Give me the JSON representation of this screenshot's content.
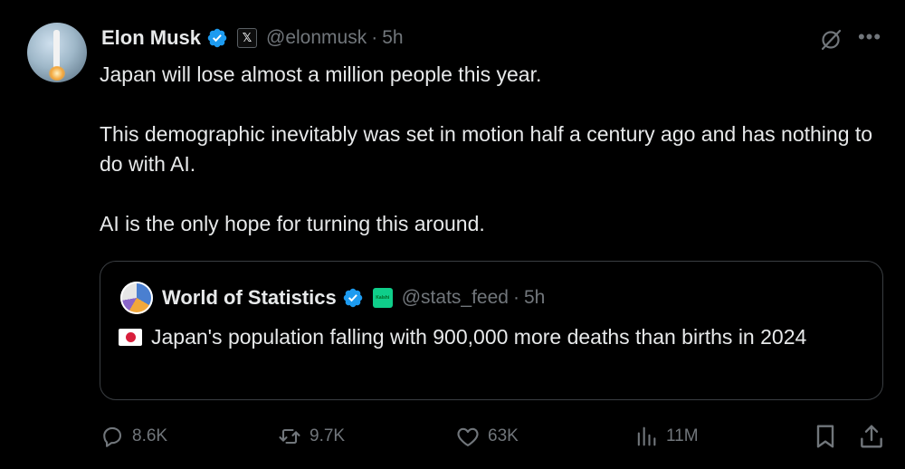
{
  "post": {
    "author_name": "Elon Musk",
    "author_handle": "@elonmusk",
    "separator": "·",
    "time": "5h",
    "x_badge": "𝕏",
    "paragraphs": [
      "Japan will lose almost a million people this year.",
      "This demographic inevitably was set in motion half a century ago and has nothing to do with AI.",
      "AI is the only hope for turning this around."
    ]
  },
  "quote": {
    "author_name": "World of Statistics",
    "author_handle": "@stats_feed",
    "separator": "·",
    "time": "5h",
    "affiliate_badge": "Kalshi",
    "text": "Japan's population falling with 900,000 more deaths than births in 2024"
  },
  "actions": {
    "replies": "8.6K",
    "reposts": "9.7K",
    "likes": "63K",
    "views": "11M"
  },
  "icons": {
    "verified": "verified-badge-icon",
    "grok": "grok-icon",
    "more": "more-icon",
    "reply": "reply-icon",
    "repost": "repost-icon",
    "like": "like-icon",
    "views": "views-icon",
    "bookmark": "bookmark-icon",
    "share": "share-icon",
    "flag": "japan-flag-icon"
  },
  "colors": {
    "background": "#000000",
    "text": "#e7e9ea",
    "muted": "#71767b",
    "verified": "#1d9bf0",
    "border": "#3a3e42"
  }
}
